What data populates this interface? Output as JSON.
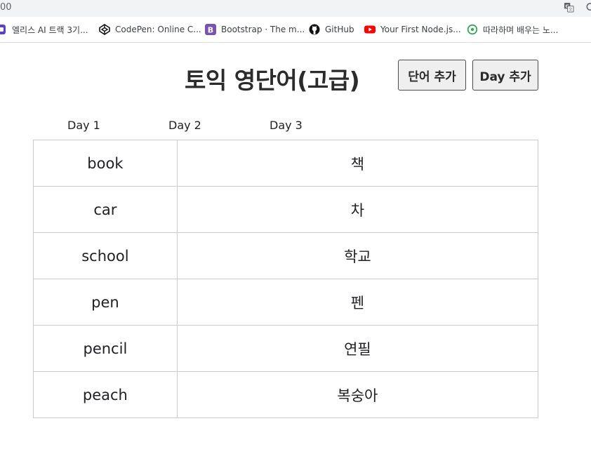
{
  "browser": {
    "address_text": "00"
  },
  "bookmarks": [
    {
      "label": "엘리스 AI 트랙 3기...",
      "icon": "elice-icon",
      "color": "#5b3fd1"
    },
    {
      "label": "CodePen: Online C...",
      "icon": "codepen-icon",
      "color": "#111111"
    },
    {
      "label": "Bootstrap · The m...",
      "icon": "bootstrap-icon",
      "color": "#7952b3"
    },
    {
      "label": "GitHub",
      "icon": "github-icon",
      "color": "#111111"
    },
    {
      "label": "Your First Node.js...",
      "icon": "youtube-icon",
      "color": "#ff0000"
    },
    {
      "label": "따라하며 배우는 노...",
      "icon": "learning-icon",
      "color": "#34a853"
    }
  ],
  "header": {
    "title": "토익 영단어(고급)",
    "add_word_button": "단어 추가",
    "add_day_button": "Day 추가"
  },
  "day_tabs": [
    {
      "label": "Day 1"
    },
    {
      "label": "Day 2"
    },
    {
      "label": "Day 3"
    }
  ],
  "words": [
    {
      "eng": "book",
      "kor": "책"
    },
    {
      "eng": "car",
      "kor": "차"
    },
    {
      "eng": "school",
      "kor": "학교"
    },
    {
      "eng": "pen",
      "kor": "펜"
    },
    {
      "eng": "pencil",
      "kor": "연필"
    },
    {
      "eng": "peach",
      "kor": "복숭아"
    }
  ]
}
